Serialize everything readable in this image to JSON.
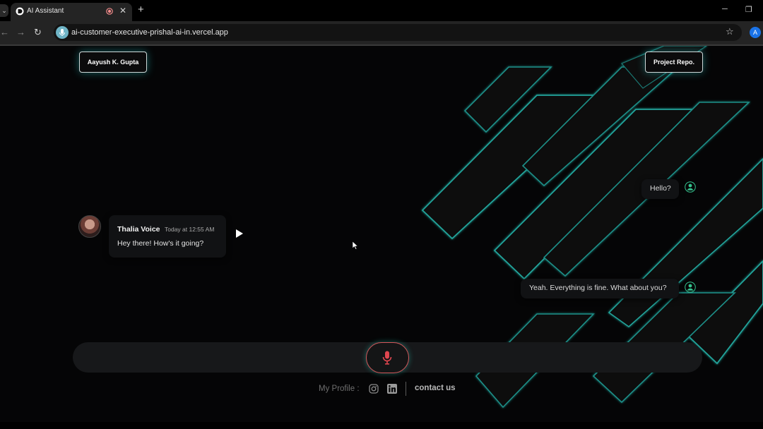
{
  "browser": {
    "tab_title": "AI Assistant",
    "url": "ai-customer-executive-prishal-ai-in.vercel.app",
    "profile_initial": "A",
    "icons": [
      "tab-search-icon",
      "record-icon",
      "close-icon",
      "plus-icon",
      "minimize-icon",
      "restore-icon",
      "back-arrow-icon",
      "forward-arrow-icon",
      "reload-icon",
      "star-icon"
    ]
  },
  "header": {
    "author_button": "Aayush K. Gupta",
    "repo_button": "Project Repo."
  },
  "chat": {
    "messages": [
      {
        "role": "user",
        "text": "Hello?"
      },
      {
        "role": "assistant",
        "name": "Thalia Voice",
        "time": "Today at 12:55 AM",
        "text": "Hey there! How's it going?"
      },
      {
        "role": "user",
        "text": "Yeah. Everything is fine. What about you?"
      }
    ]
  },
  "input": {
    "mic_state": "idle",
    "mic_color": "#e0464f"
  },
  "footer": {
    "profile_label": "My Profile :",
    "social_icons": [
      "instagram-icon",
      "linkedin-icon"
    ],
    "contact_label": "contact us"
  },
  "theme": {
    "background": "#050506",
    "accent": "#28c8b4"
  }
}
